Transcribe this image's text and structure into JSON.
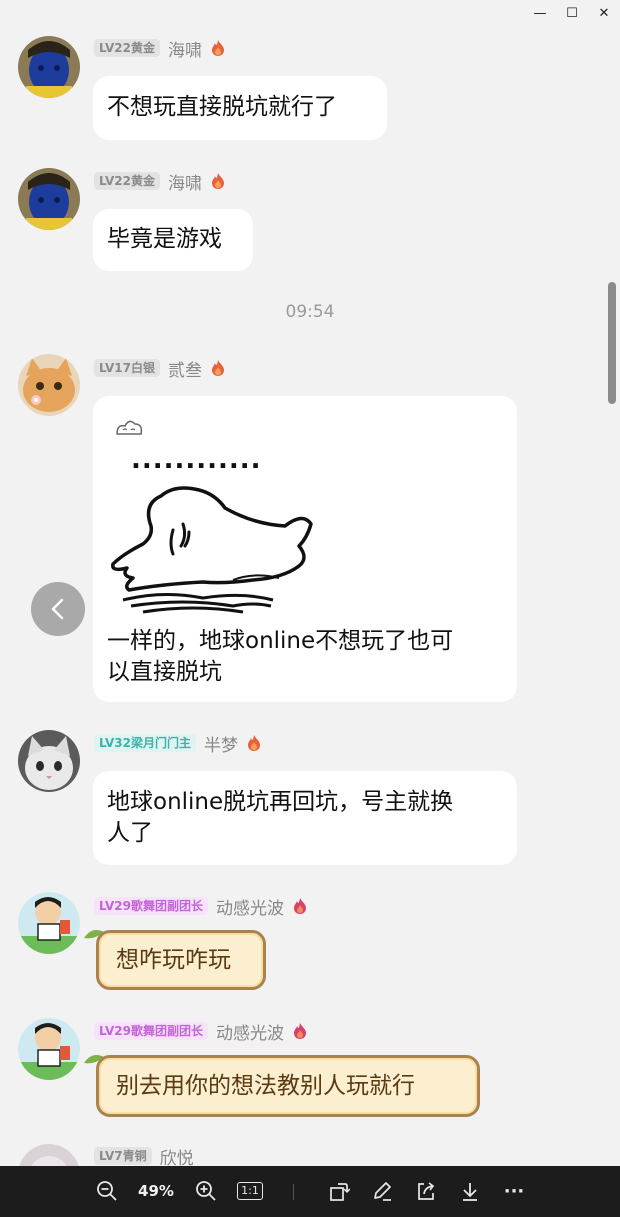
{
  "window": {
    "controls": {
      "minimize": "—",
      "maximize": "☐",
      "close": "✕"
    }
  },
  "messages": [
    {
      "level": "LV22黄金",
      "name": "海啸",
      "text": "不想玩直接脱坑就行了"
    },
    {
      "level": "LV22黄金",
      "name": "海啸",
      "text": "毕竟是游戏"
    },
    {
      "level": "LV17白银",
      "name": "贰叁",
      "text_line1": "一样的，地球online不想玩了也可",
      "text_line2": "以直接脱坑"
    },
    {
      "level": "LV32梁月门门主",
      "name": "半梦",
      "text_line1": "地球online脱坑再回坑，号主就换",
      "text_line2": "人了"
    },
    {
      "level": "LV29歌舞团副团长",
      "name": "动感光波",
      "text": "想咋玩咋玩"
    },
    {
      "level": "LV29歌舞团副团长",
      "name": "动感光波",
      "text": "别去用你的想法教别人玩就行"
    },
    {
      "level": "LV7青铜",
      "name": "欣悦"
    }
  ],
  "timestamp": "09:54",
  "sticker": {
    "dots": "............"
  },
  "viewer_toolbar": {
    "zoom": "49%",
    "actual_size_label": "1:1",
    "more_label": "···"
  },
  "colors": {
    "badge_gray": "#e3e3e3",
    "badge_teal": "#dff3f1",
    "badge_pink": "#f6e3fa",
    "gold_bubble": "#fbefcf",
    "toolbar_bg": "#1c1c1c"
  }
}
